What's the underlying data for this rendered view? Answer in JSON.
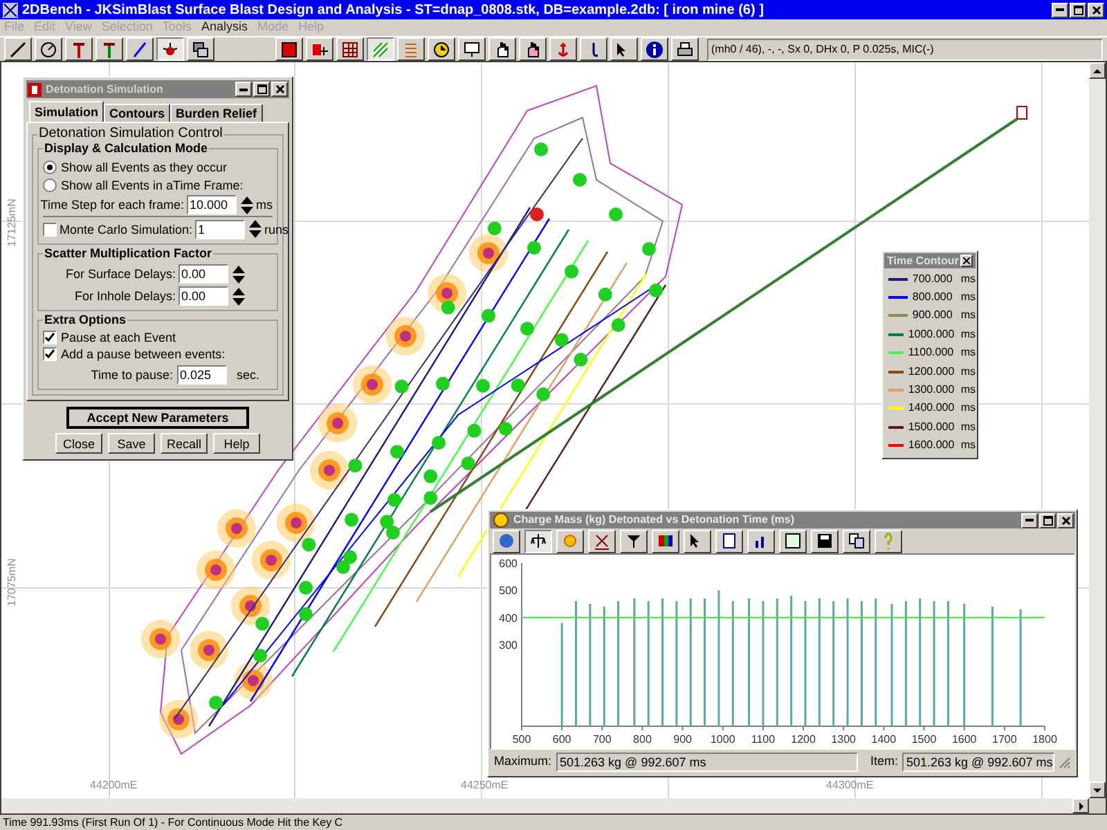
{
  "window": {
    "title": "2DBench - JKSimBlast Surface Blast Design and Analysis - ST=dnap_0808.stk, DB=example.2db: [ iron mine (6) ]"
  },
  "menu": [
    {
      "label": "File",
      "disabled": true
    },
    {
      "label": "Edit",
      "disabled": true
    },
    {
      "label": "View",
      "disabled": true
    },
    {
      "label": "Selection",
      "disabled": true
    },
    {
      "label": "Tools",
      "disabled": true
    },
    {
      "label": "Analysis",
      "disabled": false
    },
    {
      "label": "Mode",
      "disabled": true
    },
    {
      "label": "Help",
      "disabled": true
    }
  ],
  "toolbar": {
    "info": "(mh0 / 46), -, -, Sx 0, DHx 0, P 0.025s, MIC(-)"
  },
  "canvas": {
    "y_labels": [
      "17125mN",
      "17075mN"
    ],
    "x_labels": [
      "44200mE",
      "44250mE",
      "44300mE"
    ]
  },
  "detonation_dialog": {
    "title": "Detonation Simulation",
    "tabs": [
      {
        "label": "Simulation",
        "selected": true
      },
      {
        "label": "Contours",
        "selected": false
      },
      {
        "label": "Burden Relief",
        "selected": false
      }
    ],
    "group_title": "Detonation Simulation Control",
    "mode": {
      "title": "Display & Calculation  Mode",
      "options": [
        {
          "label": "Show all Events as they occur",
          "selected": true
        },
        {
          "label": "Show all Events in aTime Frame:",
          "selected": false
        }
      ],
      "time_step": {
        "label": "Time Step for each frame:",
        "value": "10.000",
        "unit": "ms"
      },
      "monte_carlo": {
        "label": "Monte Carlo Simulation:",
        "checked": false,
        "value": "1",
        "unit": "runs"
      }
    },
    "scatter": {
      "title": "Scatter Multiplication Factor",
      "fields": [
        {
          "label": "For Surface Delays:",
          "value": "0.00"
        },
        {
          "label": "For Inhole Delays:",
          "value": "0.00"
        }
      ]
    },
    "extra": {
      "title": "Extra Options",
      "options": [
        {
          "label": "Pause at each Event",
          "checked": true
        },
        {
          "label": "Add a pause between events:",
          "checked": true
        }
      ],
      "pause": {
        "label": "Time to pause:",
        "value": "0.025",
        "unit": "sec."
      }
    },
    "accept": "Accept New Parameters",
    "buttons": [
      "Close",
      "Save",
      "Recall",
      "Help"
    ]
  },
  "time_contour": {
    "title": "Time Contour",
    "items": [
      {
        "value": "700.000",
        "unit": "ms",
        "color": "#1a1a80"
      },
      {
        "value": "800.000",
        "unit": "ms",
        "color": "#0000ff"
      },
      {
        "value": "900.000",
        "unit": "ms",
        "color": "#8b8b5a"
      },
      {
        "value": "1000.000",
        "unit": "ms",
        "color": "#008040"
      },
      {
        "value": "1100.000",
        "unit": "ms",
        "color": "#40ff40"
      },
      {
        "value": "1200.000",
        "unit": "ms",
        "color": "#8b4513"
      },
      {
        "value": "1300.000",
        "unit": "ms",
        "color": "#e0a060"
      },
      {
        "value": "1400.000",
        "unit": "ms",
        "color": "#ffff00"
      },
      {
        "value": "1500.000",
        "unit": "ms",
        "color": "#5a1a1a"
      },
      {
        "value": "1600.000",
        "unit": "ms",
        "color": "#ff0000"
      }
    ]
  },
  "chart_window": {
    "title": "Charge Mass (kg) Detonated vs Detonation Time (ms)",
    "chart_data": {
      "type": "bar",
      "x": [
        600,
        635,
        670,
        705,
        740,
        780,
        815,
        850,
        885,
        920,
        955,
        990,
        1025,
        1065,
        1100,
        1135,
        1170,
        1205,
        1240,
        1275,
        1310,
        1345,
        1380,
        1420,
        1455,
        1490,
        1525,
        1560,
        1600,
        1670,
        1740
      ],
      "series": [
        {
          "color": "#5aa8a8",
          "values": [
            380,
            460,
            450,
            440,
            460,
            470,
            460,
            470,
            460,
            470,
            470,
            500,
            460,
            470,
            460,
            470,
            480,
            460,
            470,
            460,
            470,
            460,
            470,
            450,
            460,
            470,
            460,
            460,
            450,
            440,
            430
          ]
        }
      ],
      "xlim": [
        500,
        1800
      ],
      "ylim": [
        0,
        600
      ],
      "xticks": [
        500,
        600,
        700,
        800,
        900,
        1000,
        1100,
        1200,
        1300,
        1400,
        1500,
        1600,
        1700,
        1800
      ],
      "yticks": [
        300,
        400,
        500,
        600
      ],
      "ref_lines": [
        {
          "axis": "y",
          "value": 400
        }
      ]
    },
    "maximum": {
      "label": "Maximum:",
      "value": "501.263 kg @ 992.607 ms"
    },
    "item": {
      "label": "Item:",
      "value": "501.263 kg @ 992.607 ms"
    }
  },
  "status_bar": "Time 991.93ms (First Run Of 1) - For Continuous Mode Hit the Key C"
}
